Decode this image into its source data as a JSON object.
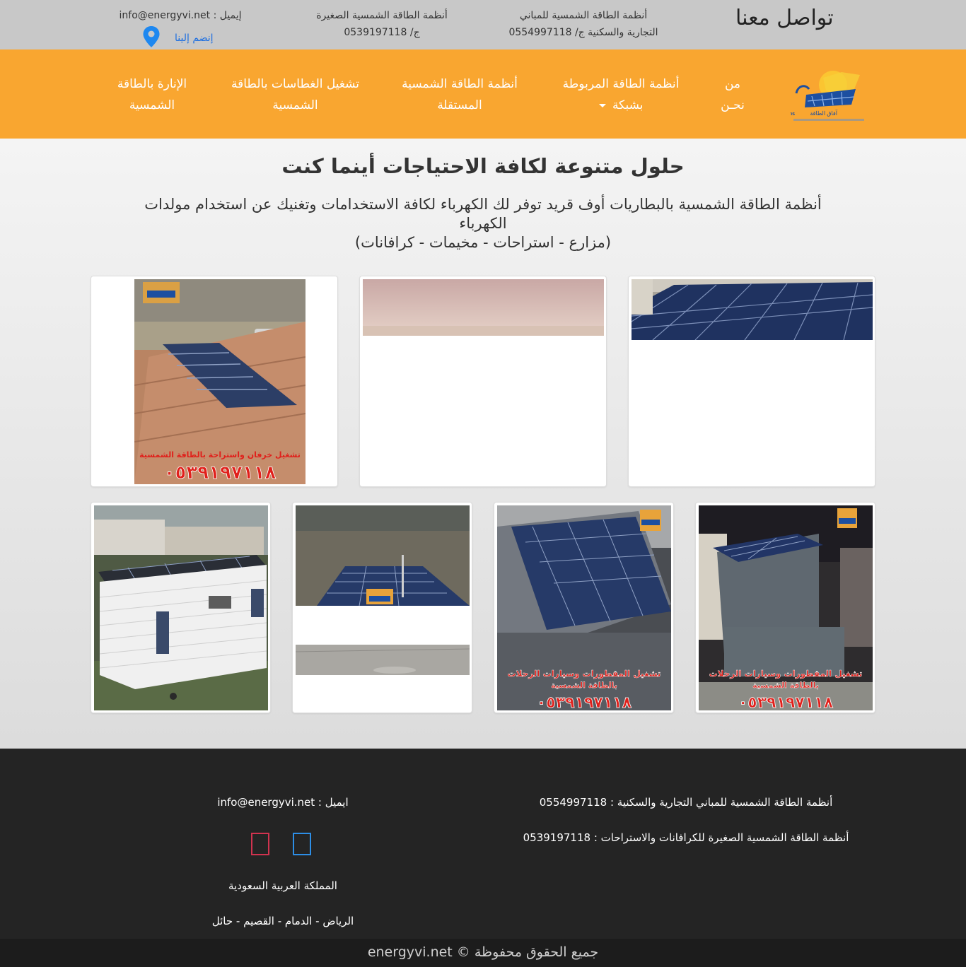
{
  "topbar": {
    "contact_title": "تواصل معنا",
    "buildings_line1": "أنظمة الطاقة الشمسية للمباني",
    "buildings_line2": "التجارية والسكنية ج/ 0554997118",
    "small_line1": "أنظمة الطاقة الشمسية الصغيرة",
    "small_line2": "ج/ 0539197118",
    "email": "إيميل : info@energyvi.net",
    "join_label": "إنضم إلينا",
    "pin_icon": "location-pin-icon"
  },
  "nav": {
    "logo_alt": "Energy Visions",
    "about_line1": "من",
    "about_line2": "نحـن",
    "grid_line1": "أنظمة الطاقة المربوطة",
    "grid_line2": "بشبكة",
    "standalone_line1": "أنظمة الطاقة الشمسية",
    "standalone_line2": "المستقلة",
    "pumps_line1": "تشغيل الغطاسات بالطاقة",
    "pumps_line2": "الشمسية",
    "lighting_line1": "الإنارة بالطاقة",
    "lighting_line2": "الشمسية"
  },
  "main": {
    "title": "حلول متنوعة لكافة الاحتياجات أينما كنت",
    "subtitle_line1": "أنظمة الطاقة الشمسية بالبطاريات أوف قريد توفر لك الكهرباء لكافة الاستخدامات وتغنيك عن استخدام مولدات",
    "subtitle_line2": "الكهرباء",
    "subtitle_line3": "(مزارع - استراحات - مخيمات - كرافانات)"
  },
  "gallery": {
    "photo1_caption": "تشغيل خرفان واستراحة بالطاقة الشمسية",
    "photo1_phone": "٠٥٣٩١٩٧١١٨",
    "photo4_caption_line1": "تشغيل المقطورات وسيارات الرحلات",
    "photo4_caption_line2": "بالطاقة الشمسية",
    "photo4_phone": "٠٥٣٩١٩٧١١٨",
    "photo5_caption_line1": "تشغيل المقطورات وسيارات الرحلات",
    "photo5_caption_line2": "بالطاقة الشمسية",
    "photo5_phone": "٠٥٣٩١٩٧١١٨"
  },
  "footer": {
    "buildings": "أنظمة الطاقة الشمسية للمباني التجارية والسكنية : 0554997118",
    "small": "أنظمة الطاقة الشمسية الصغيرة للكرافانات والاستراحات : 0539197118",
    "email": "ايميل : info@energyvi.net",
    "country": "المملكة العربية السعودية",
    "cities": "الرياض - الدمام - القصيم - حائل",
    "social_icons": [
      "instagram-icon",
      "facebook-icon"
    ],
    "copyright": "جميع الحقوق محفوظة © energyvi.net"
  },
  "colors": {
    "topbar_bg": "#c8c8c8",
    "nav_bg": "#f9a630",
    "footer_bg": "#242424",
    "link_blue": "#1e6fe0",
    "caption_red": "#e0201b"
  }
}
